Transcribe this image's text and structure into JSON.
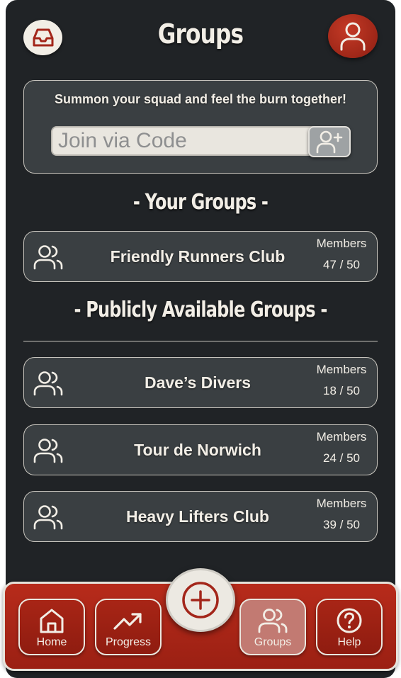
{
  "header": {
    "title": "Groups",
    "inbox_icon": "inbox-icon",
    "profile_icon": "user-icon"
  },
  "join": {
    "tagline": "Summon your squad and feel the burn together!",
    "placeholder": "Join via Code",
    "value": "",
    "button_icon": "add-user-icon"
  },
  "sections": {
    "your_groups": "- Your Groups -",
    "public_groups": "- Publicly Available Groups -"
  },
  "your_groups": [
    {
      "name": "Friendly Runners Club",
      "members_label": "Members",
      "members": "47 / 50"
    }
  ],
  "public_groups": [
    {
      "name": "Dave’s Divers",
      "members_label": "Members",
      "members": "18 / 50"
    },
    {
      "name": "Tour de Norwich",
      "members_label": "Members",
      "members": "24 / 50"
    },
    {
      "name": "Heavy Lifters Club",
      "members_label": "Members",
      "members": "39 / 50"
    }
  ],
  "nav": {
    "items": [
      {
        "label": "Home",
        "icon": "home-icon",
        "active": false
      },
      {
        "label": "Progress",
        "icon": "trending-up-icon",
        "active": false
      },
      {
        "label": "Groups",
        "icon": "users-icon",
        "active": true
      },
      {
        "label": "Help",
        "icon": "help-icon",
        "active": false
      }
    ],
    "add_icon": "plus-circle-icon"
  },
  "colors": {
    "background": "#202326",
    "card": "#3a3f42",
    "accent_red": "#b72b1b",
    "text_light": "#f2eee6"
  }
}
